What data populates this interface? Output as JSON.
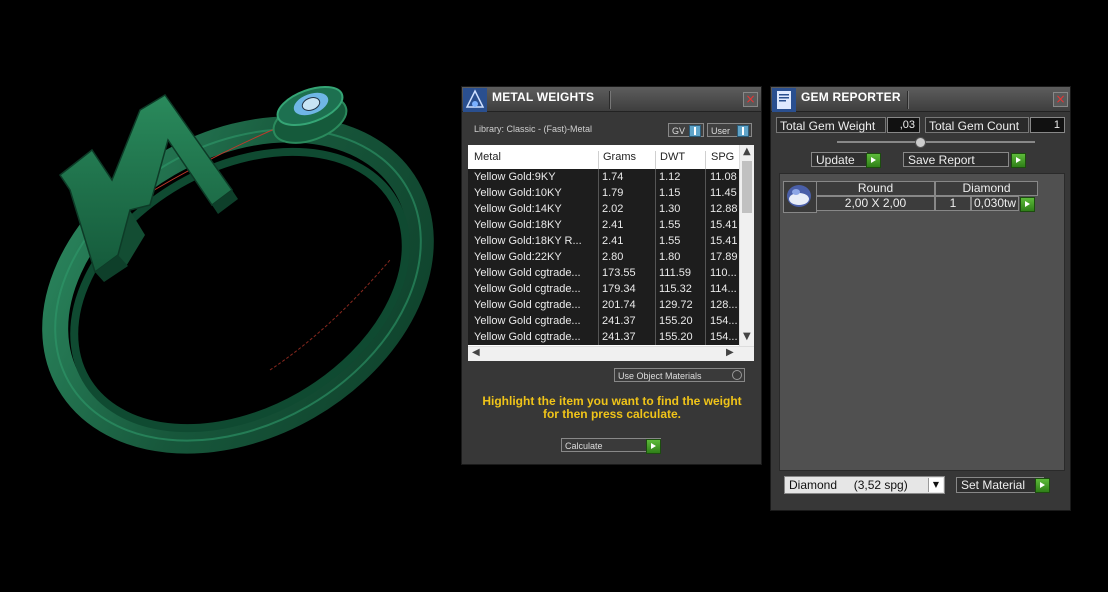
{
  "metal_weights": {
    "title": "METAL WEIGHTS",
    "library": "Library: Classic - (Fast)-Metal",
    "toggle_gv": "GV",
    "toggle_user": "User",
    "columns": [
      "Metal",
      "Grams",
      "DWT",
      "SPG"
    ],
    "rows": [
      [
        "Yellow Gold:9KY",
        "1.74",
        "1.12",
        "11.08"
      ],
      [
        "Yellow Gold:10KY",
        "1.79",
        "1.15",
        "11.45"
      ],
      [
        "Yellow Gold:14KY",
        "2.02",
        "1.30",
        "12.88"
      ],
      [
        "Yellow Gold:18KY",
        "2.41",
        "1.55",
        "15.41"
      ],
      [
        "Yellow Gold:18KY R...",
        "2.41",
        "1.55",
        "15.41"
      ],
      [
        "Yellow Gold:22KY",
        "2.80",
        "1.80",
        "17.89"
      ],
      [
        "Yellow Gold cgtrade...",
        "173.55",
        "111.59",
        "110..."
      ],
      [
        "Yellow Gold cgtrade...",
        "179.34",
        "115.32",
        "114..."
      ],
      [
        "Yellow Gold cgtrade...",
        "201.74",
        "129.72",
        "128..."
      ],
      [
        "Yellow Gold cgtrade...",
        "241.37",
        "155.20",
        "154..."
      ],
      [
        "Yellow Gold cgtrade...",
        "241.37",
        "155.20",
        "154..."
      ]
    ],
    "use_object_materials": "Use Object Materials",
    "instruction_line1": "Highlight the item you want to find the weight",
    "instruction_line2": "for then press calculate.",
    "calculate_label": "Calculate"
  },
  "gem_reporter": {
    "title": "GEM REPORTER",
    "total_weight_label": "Total Gem Weight",
    "total_weight_value": ",03",
    "total_count_label": "Total Gem Count",
    "total_count_value": "1",
    "update_label": "Update",
    "save_report_label": "Save Report",
    "gem_shape": "Round",
    "gem_type": "Diamond",
    "gem_size": "2,00 X 2,00",
    "gem_count": "1",
    "gem_weight": "0,030tw",
    "material_select": "Diamond     (3,52 spg)",
    "set_material_label": "Set Material"
  },
  "colors": {
    "ring_green": "#1d6b4a",
    "instruction_yellow": "#f0c419",
    "button_green": "#3f9c24"
  }
}
